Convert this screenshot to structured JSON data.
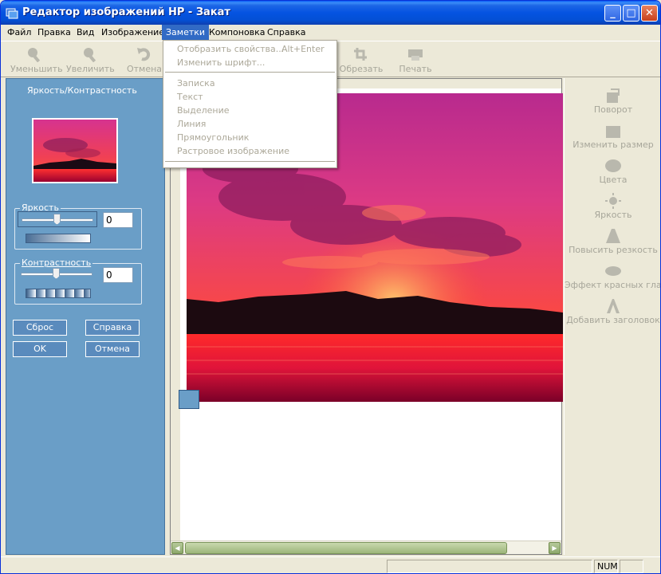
{
  "window": {
    "title": "Редактор изображений HP - Закат",
    "minimize": "_",
    "maximize": "□",
    "close": "✕"
  },
  "menu": [
    "Файл",
    "Правка",
    "Вид",
    "Изображение",
    "Заметки",
    "Компоновка",
    "Справка"
  ],
  "toolbar": {
    "zoom_out": "Уменьшить",
    "zoom_in": "Увеличить",
    "undo": "Отмена",
    "crop": "Обрезать",
    "print": "Печать"
  },
  "dropdown": {
    "show_properties": "Отобразить свойства...",
    "show_properties_shortcut": "Alt+Enter",
    "change_font": "Изменить шрифт...",
    "note": "Записка",
    "text": "Текст",
    "highlight": "Выделение",
    "line": "Линия",
    "rectangle": "Прямоугольник",
    "bitmap": "Растровое изображение"
  },
  "left_panel": {
    "title": "Яркость/Контрастность",
    "brightness_label": "Яркость",
    "brightness_value": "0",
    "contrast_label": "Контрастность",
    "contrast_value": "0",
    "reset": "Сброс",
    "help": "Справка",
    "ok": "OK",
    "cancel": "Отмена"
  },
  "right_panel": {
    "rotate": "Поворот",
    "resize": "Изменить размер",
    "colors": "Цвета",
    "brightness": "Яркость",
    "sharpen": "Повысить резкость",
    "red_eye": "Эффект красных глаз",
    "add_caption": "Добавить заголовок"
  },
  "status": {
    "num": "NUM"
  },
  "colors": {
    "panel_blue": "#6a9ec7",
    "menu_highlight": "#316ac5",
    "disabled_text": "#a7a69a"
  }
}
